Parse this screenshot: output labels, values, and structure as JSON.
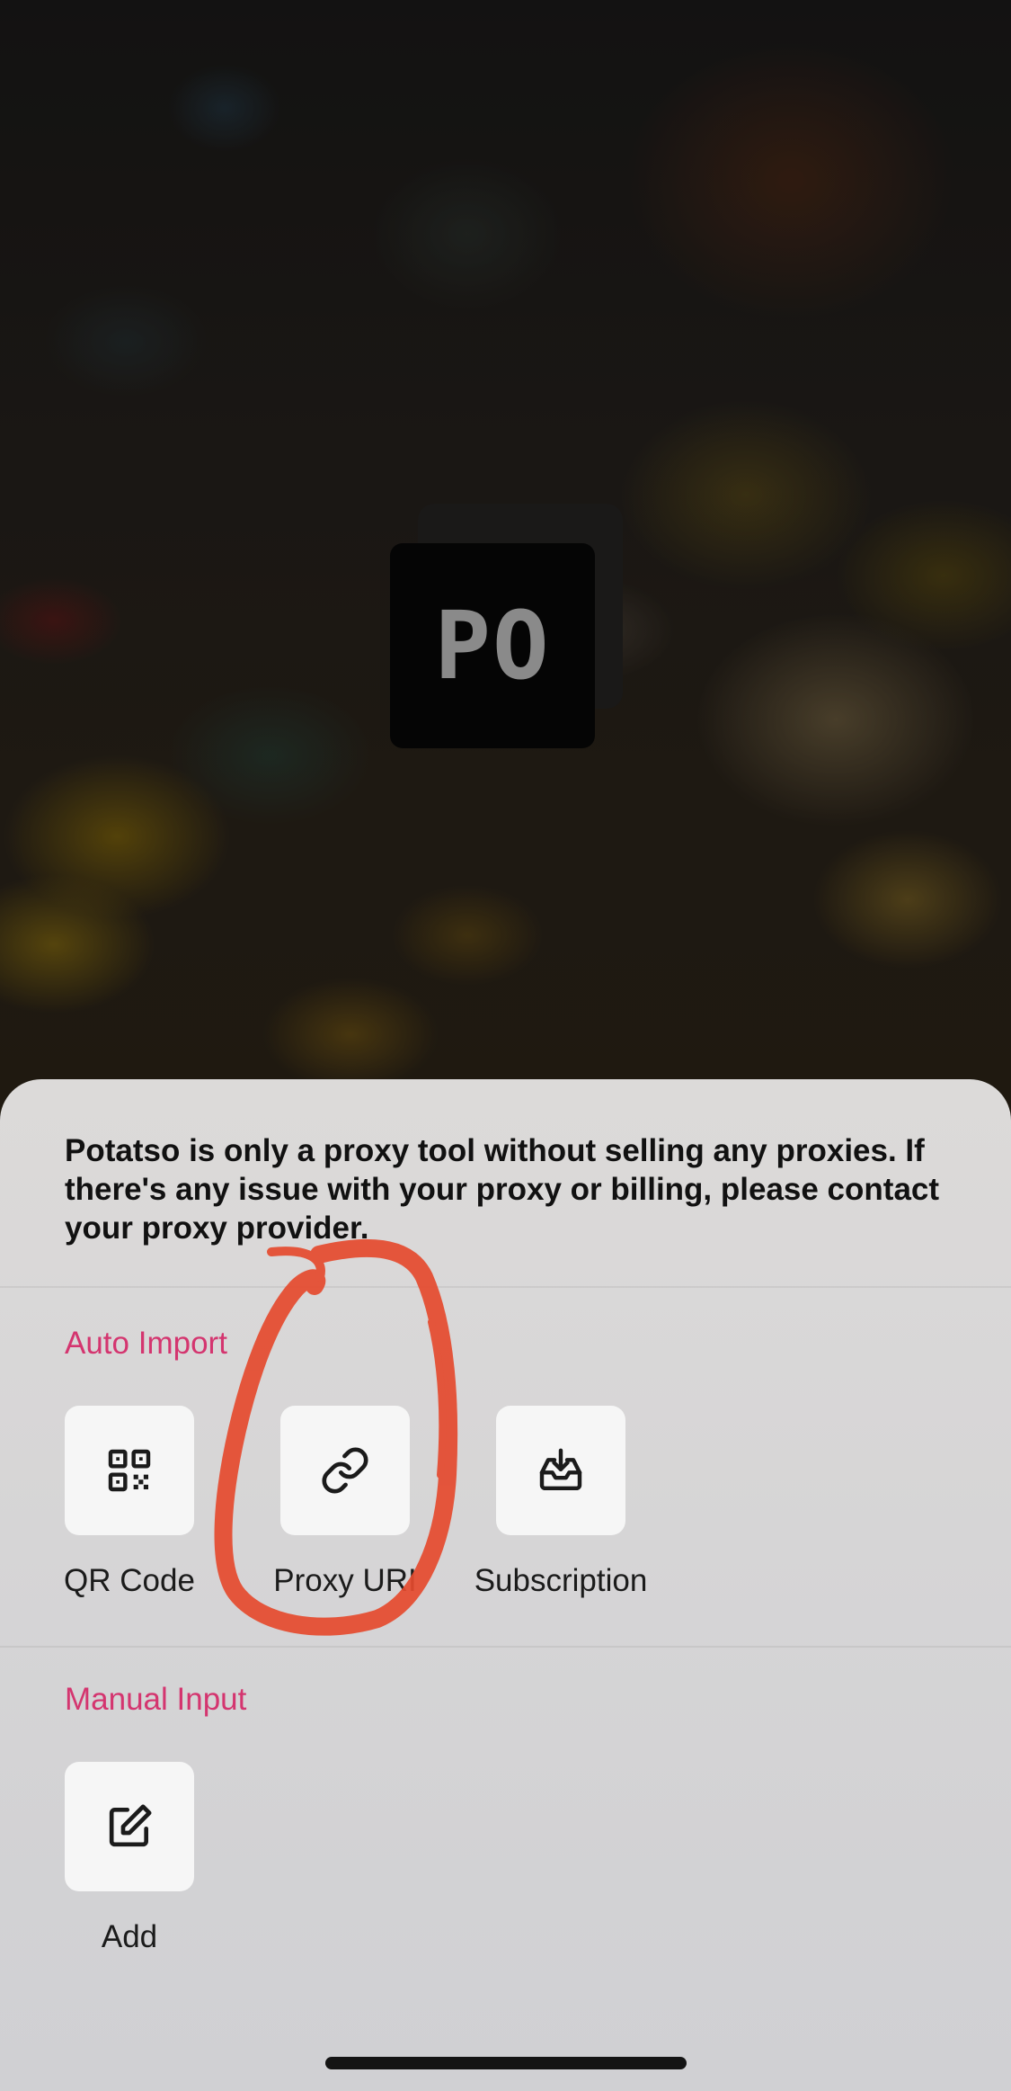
{
  "app": {
    "logo_text": "PO",
    "colors": {
      "accent": "#d4356f",
      "annotation": "#e54a2e",
      "tile_bg": "#f6f6f6"
    }
  },
  "sheet": {
    "disclaimer": "Potatso is only a proxy tool without selling any proxies. If there's any issue with your proxy or billing, please contact your proxy provider.",
    "auto_import": {
      "title": "Auto Import",
      "items": [
        {
          "label": "QR Code",
          "icon": "qr-code-icon"
        },
        {
          "label": "Proxy URI",
          "icon": "link-icon"
        },
        {
          "label": "Subscription",
          "icon": "inbox-download-icon"
        }
      ]
    },
    "manual_input": {
      "title": "Manual Input",
      "items": [
        {
          "label": "Add",
          "icon": "edit-icon"
        }
      ]
    }
  }
}
